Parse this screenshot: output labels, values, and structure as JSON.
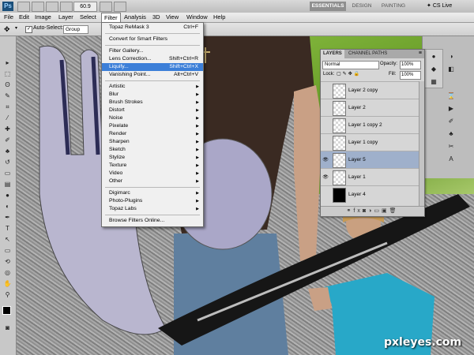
{
  "app": {
    "logo": "Ps",
    "zoom": "60.9"
  },
  "workspaces": [
    "ESSENTIALS",
    "DESIGN",
    "PAINTING"
  ],
  "cs_live": "CS Live",
  "menubar": [
    "File",
    "Edit",
    "Image",
    "Layer",
    "Select",
    "Filter",
    "Analysis",
    "3D",
    "View",
    "Window",
    "Help"
  ],
  "options": {
    "auto_select": "Auto-Select:",
    "auto_select_value": "Group"
  },
  "filter_menu": {
    "items": [
      {
        "label": "Topaz ReMask 3",
        "shortcut": "Ctrl+F"
      },
      {
        "sep": true
      },
      {
        "label": "Convert for Smart Filters"
      },
      {
        "sep": true
      },
      {
        "label": "Filter Gallery..."
      },
      {
        "label": "Lens Correction...",
        "shortcut": "Shift+Ctrl+R"
      },
      {
        "label": "Liquify...",
        "shortcut": "Shift+Ctrl+X",
        "highlight": true
      },
      {
        "label": "Vanishing Point...",
        "shortcut": "Alt+Ctrl+V"
      },
      {
        "sep": true
      },
      {
        "label": "Artistic",
        "submenu": true
      },
      {
        "label": "Blur",
        "submenu": true
      },
      {
        "label": "Brush Strokes",
        "submenu": true
      },
      {
        "label": "Distort",
        "submenu": true
      },
      {
        "label": "Noise",
        "submenu": true
      },
      {
        "label": "Pixelate",
        "submenu": true
      },
      {
        "label": "Render",
        "submenu": true
      },
      {
        "label": "Sharpen",
        "submenu": true
      },
      {
        "label": "Sketch",
        "submenu": true
      },
      {
        "label": "Stylize",
        "submenu": true
      },
      {
        "label": "Texture",
        "submenu": true
      },
      {
        "label": "Video",
        "submenu": true
      },
      {
        "label": "Other",
        "submenu": true
      },
      {
        "sep": true
      },
      {
        "label": "Digimarc",
        "submenu": true
      },
      {
        "label": "Photo-Plugins",
        "submenu": true
      },
      {
        "label": "Topaz Labs",
        "submenu": true
      },
      {
        "sep": true
      },
      {
        "label": "Browse Filters Online..."
      }
    ]
  },
  "layers_panel": {
    "tabs": [
      "LAYERS",
      "CHANNEL PATHS"
    ],
    "blend_mode": "Normal",
    "opacity_label": "Opacity:",
    "opacity": "100%",
    "lock_label": "Lock:",
    "fill_label": "Fill:",
    "fill": "100%",
    "layers": [
      {
        "name": "Layer 2 copy",
        "visible": false,
        "selected": false,
        "thumb": "transparent"
      },
      {
        "name": "Layer 2",
        "visible": false,
        "selected": false,
        "thumb": "transparent"
      },
      {
        "name": "Layer 1 copy 2",
        "visible": false,
        "selected": false,
        "thumb": "transparent"
      },
      {
        "name": "Layer 1 copy",
        "visible": false,
        "selected": false,
        "thumb": "transparent"
      },
      {
        "name": "Layer 5",
        "visible": true,
        "selected": true,
        "thumb": "transparent"
      },
      {
        "name": "Layer 1",
        "visible": true,
        "selected": false,
        "thumb": "transparent"
      },
      {
        "name": "Layer 4",
        "visible": false,
        "selected": false,
        "thumb": "black"
      }
    ]
  },
  "watermark": "pxleyes.com"
}
